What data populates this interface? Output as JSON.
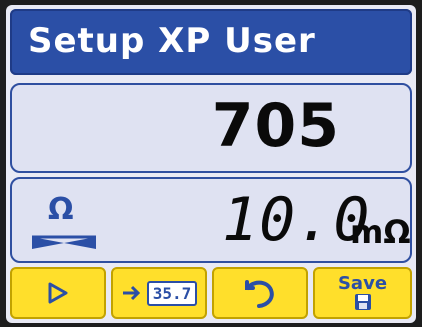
{
  "title": "Setup XP User",
  "main_value": "705",
  "measurement": {
    "value": "10.0",
    "unit": "mΩ",
    "icon": "ohm-icon"
  },
  "softkeys": [
    {
      "icon": "play-icon"
    },
    {
      "icon": "arrow-stack-icon",
      "label": "35.7"
    },
    {
      "icon": "undo-icon"
    },
    {
      "icon": "save-icon",
      "label": "Save"
    }
  ],
  "colors": {
    "title_bg": "#2b4fa6",
    "panel_bg": "#dfe2f2",
    "softkey_bg": "#ffdf2b",
    "icon_blue": "#2b4fa6"
  }
}
